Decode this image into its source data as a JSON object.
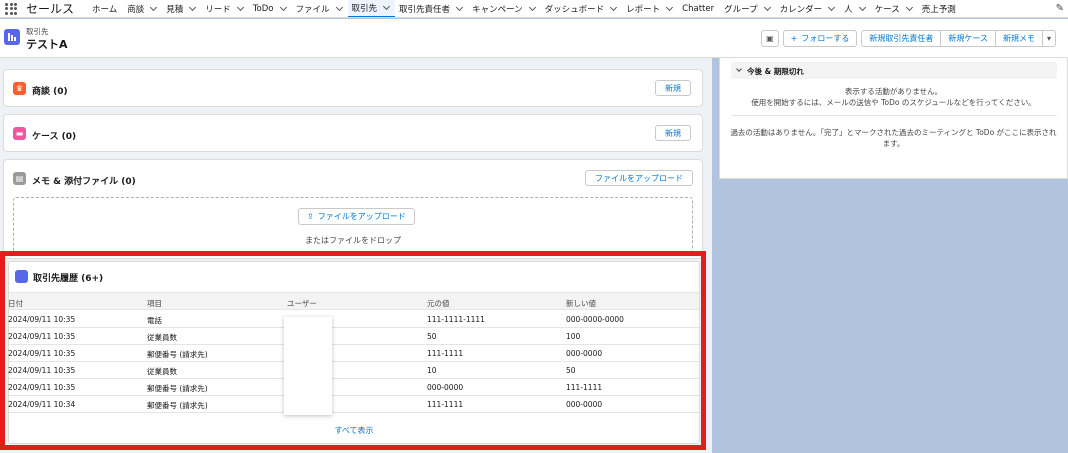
{
  "app": {
    "name": "セールス"
  },
  "nav": {
    "items": [
      {
        "label": "ホーム",
        "chev": false
      },
      {
        "label": "商談",
        "chev": true
      },
      {
        "label": "見積",
        "chev": true
      },
      {
        "label": "リード",
        "chev": true
      },
      {
        "label": "ToDo",
        "chev": true
      },
      {
        "label": "ファイル",
        "chev": true
      },
      {
        "label": "取引先",
        "chev": true,
        "active": true
      },
      {
        "label": "取引先責任者",
        "chev": true
      },
      {
        "label": "キャンペーン",
        "chev": true
      },
      {
        "label": "ダッシュボード",
        "chev": true
      },
      {
        "label": "レポート",
        "chev": true
      },
      {
        "label": "Chatter",
        "chev": false
      },
      {
        "label": "グループ",
        "chev": true
      },
      {
        "label": "カレンダー",
        "chev": true
      },
      {
        "label": "人",
        "chev": true
      },
      {
        "label": "ケース",
        "chev": true
      },
      {
        "label": "売上予測",
        "chev": false
      }
    ]
  },
  "record": {
    "object_label": "取引先",
    "name": "テストA",
    "buttons": {
      "follow": "フォローする",
      "new_contact": "新規取引先責任者",
      "new_case": "新規ケース",
      "new_note": "新規メモ"
    }
  },
  "cards": {
    "opportunities": {
      "title": "商談 (0)",
      "button": "新規"
    },
    "cases": {
      "title": "ケース (0)",
      "button": "新規"
    },
    "files": {
      "title": "メモ & 添付ファイル (0)",
      "button": "ファイルをアップロード",
      "drop_button": "ファイルをアップロード",
      "drop_text": "またはファイルをドロップ"
    }
  },
  "history": {
    "title": "取引先履歴 (6+)",
    "columns": [
      "日付",
      "項目",
      "ユーザー",
      "元の値",
      "新しい値"
    ],
    "rows": [
      [
        "2024/09/11 10:35",
        "電話",
        "",
        "111-1111-1111",
        "000-0000-0000"
      ],
      [
        "2024/09/11 10:35",
        "従業員数",
        "",
        "50",
        "100"
      ],
      [
        "2024/09/11 10:35",
        "郵便番号 (請求先)",
        "",
        "111-1111",
        "000-0000"
      ],
      [
        "2024/09/11 10:35",
        "従業員数",
        "",
        "10",
        "50"
      ],
      [
        "2024/09/11 10:35",
        "郵便番号 (請求先)",
        "",
        "000-0000",
        "111-1111"
      ],
      [
        "2024/09/11 10:34",
        "郵便番号 (請求先)",
        "",
        "111-1111",
        "000-0000"
      ]
    ],
    "view_all": "すべて表示"
  },
  "activity": {
    "upcoming_title": "今後 & 期限切れ",
    "no_activity": "表示する活動がありません。",
    "hint": "使用を開始するには、メールの送信や ToDo のスケジュールなどを行ってください。",
    "past_line1": "過去の活動はありません。「完了」とマークされた過去のミーティングと ToDo がここに表示され",
    "past_line2": "ます。"
  },
  "colors": {
    "brand": "#0176d3",
    "highlight": "#e51c1c",
    "account_icon": "#5867e8"
  }
}
